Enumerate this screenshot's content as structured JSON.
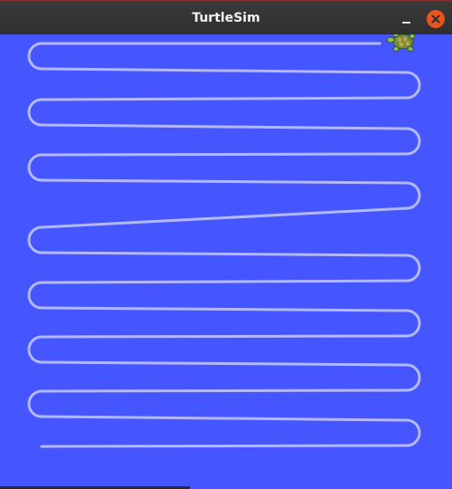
{
  "window": {
    "title": "TurtleSim",
    "minimize_icon": "minimize-icon",
    "close_icon": "close-icon"
  },
  "canvas": {
    "background_color": "#4556ff",
    "pen_color": "#b3b8ff"
  },
  "turtle": {
    "icon": "turtle-icon"
  }
}
